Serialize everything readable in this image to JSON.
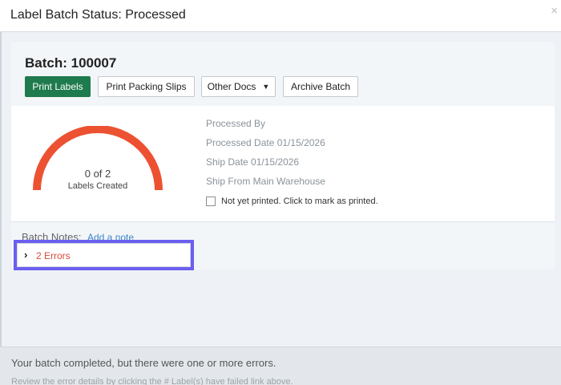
{
  "modal": {
    "title": "Label Batch Status: Processed",
    "close": "×"
  },
  "batch": {
    "title": "Batch: 100007"
  },
  "toolbar": {
    "print_labels": "Print Labels",
    "print_packing_slips": "Print Packing Slips",
    "other_docs": "Other Docs",
    "archive_batch": "Archive Batch"
  },
  "gauge": {
    "count_text": "0 of 2",
    "label": "Labels Created",
    "labels_created": 0,
    "labels_total": 2,
    "arc_color": "#ec5232"
  },
  "details": {
    "processed_by": "Processed By",
    "processed_date": "Processed Date 01/15/2026",
    "ship_date": "Ship Date 01/15/2026",
    "ship_from": "Ship From Main Warehouse",
    "printed_checkbox_label": "Not yet printed. Click to mark as printed.",
    "printed_checked": false
  },
  "notes": {
    "label": "Batch Notes:",
    "add_link": "Add a note"
  },
  "errors": {
    "label": "2 Errors",
    "color": "#d94a38"
  },
  "footer": {
    "message": "Your batch completed, but there were one or more errors.",
    "hint": "Review the error details by clicking the # Label(s) have failed link above."
  },
  "colors": {
    "primary_button": "#1e7b4d",
    "highlight_border": "#6b5ff0",
    "link": "#3a86c8"
  }
}
